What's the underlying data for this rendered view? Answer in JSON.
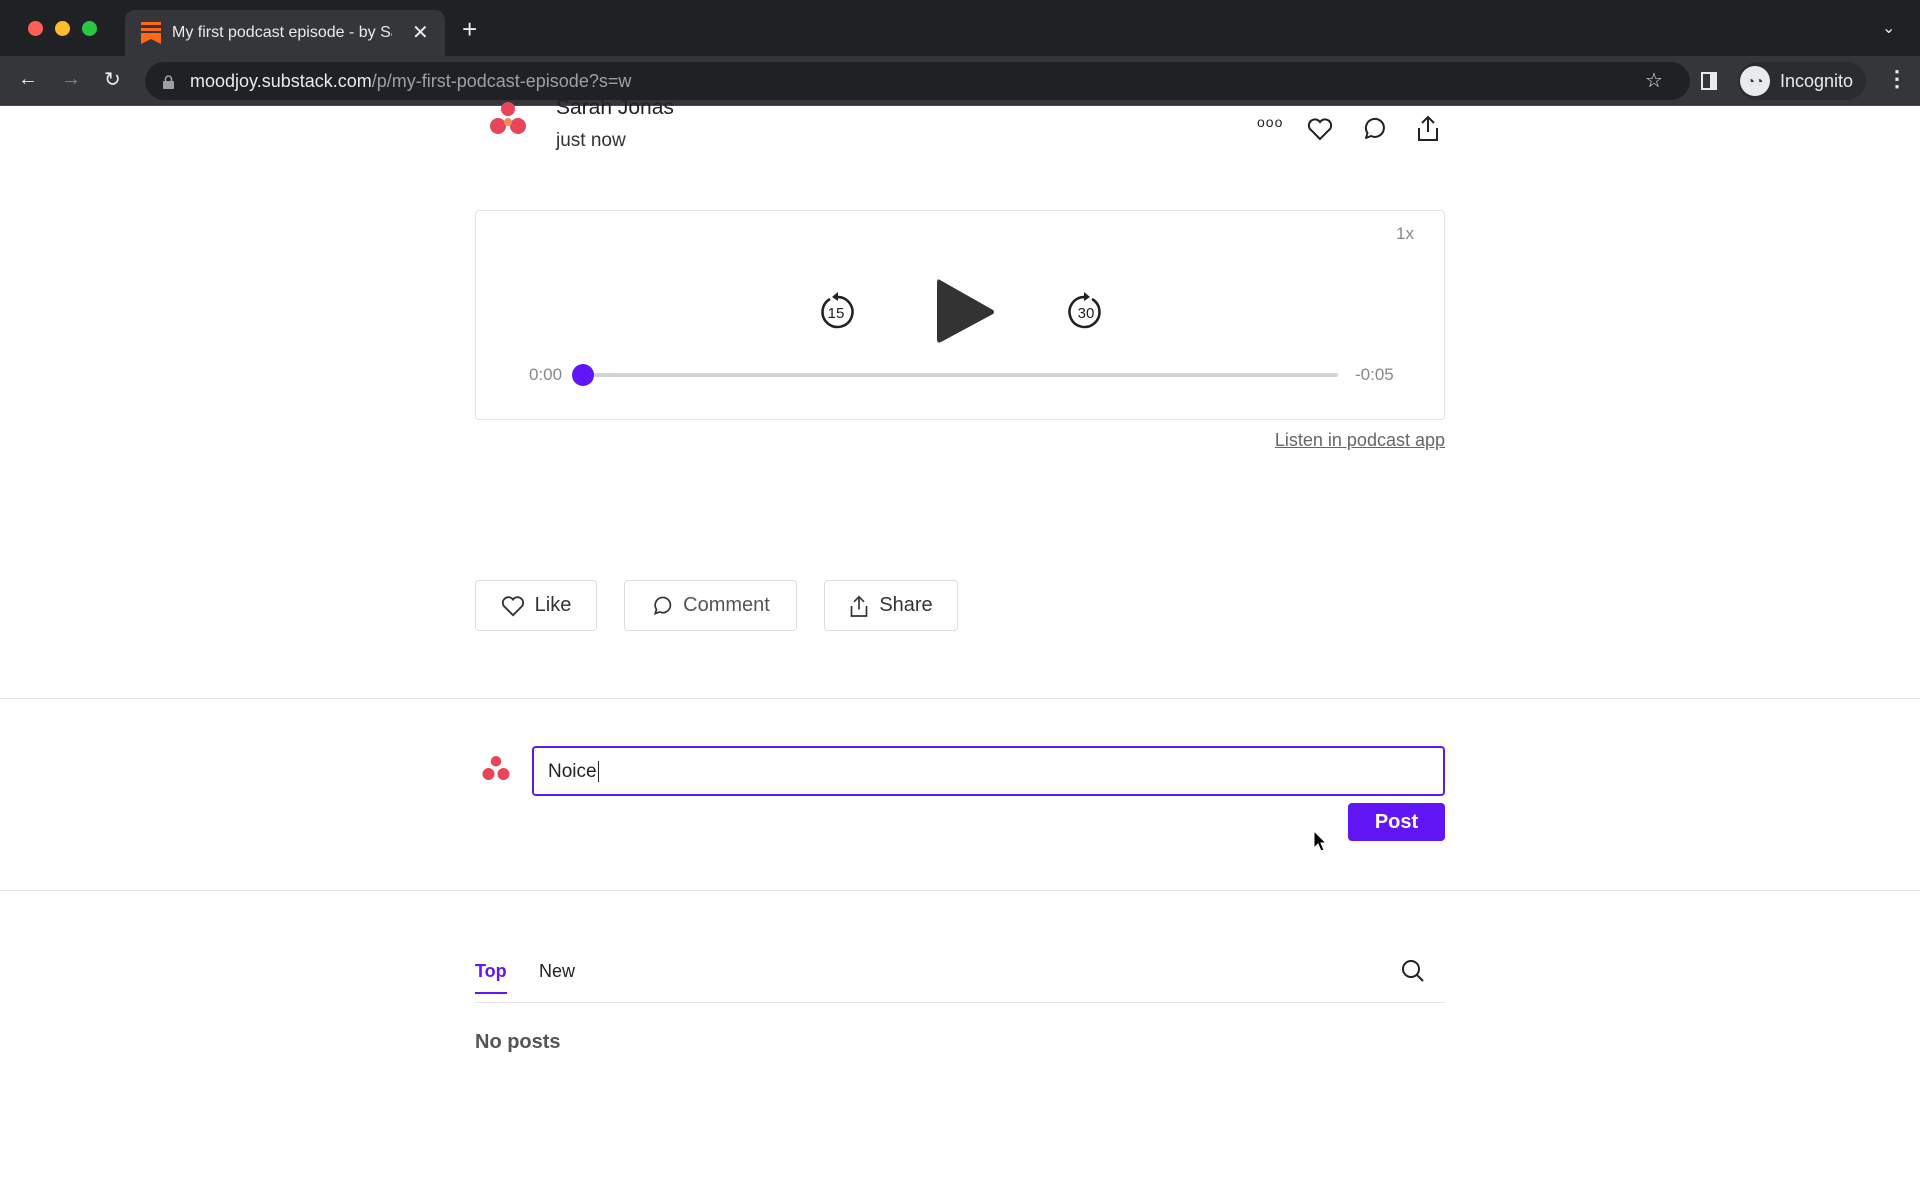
{
  "browser": {
    "tab_title": "My first podcast episode - by Sarah Jonas",
    "url_host": "moodjoy.substack.com",
    "url_path": "/p/my-first-podcast-episode?s=w",
    "profile_label": "Incognito"
  },
  "post": {
    "author": "Sarah Jonas",
    "timestamp": "just now"
  },
  "player": {
    "speed": "1x",
    "rewind_seconds": "15",
    "forward_seconds": "30",
    "elapsed": "0:00",
    "remaining": "-0:05",
    "progress_percent": 0,
    "accent": "#6016f5",
    "listen_link": "Listen in podcast app"
  },
  "actions": {
    "like": "Like",
    "comment": "Comment",
    "share": "Share"
  },
  "comment_box": {
    "value": "Noice",
    "post_label": "Post"
  },
  "comments": {
    "tabs": [
      {
        "label": "Top",
        "active": true
      },
      {
        "label": "New",
        "active": false
      }
    ],
    "empty_text": "No posts"
  }
}
